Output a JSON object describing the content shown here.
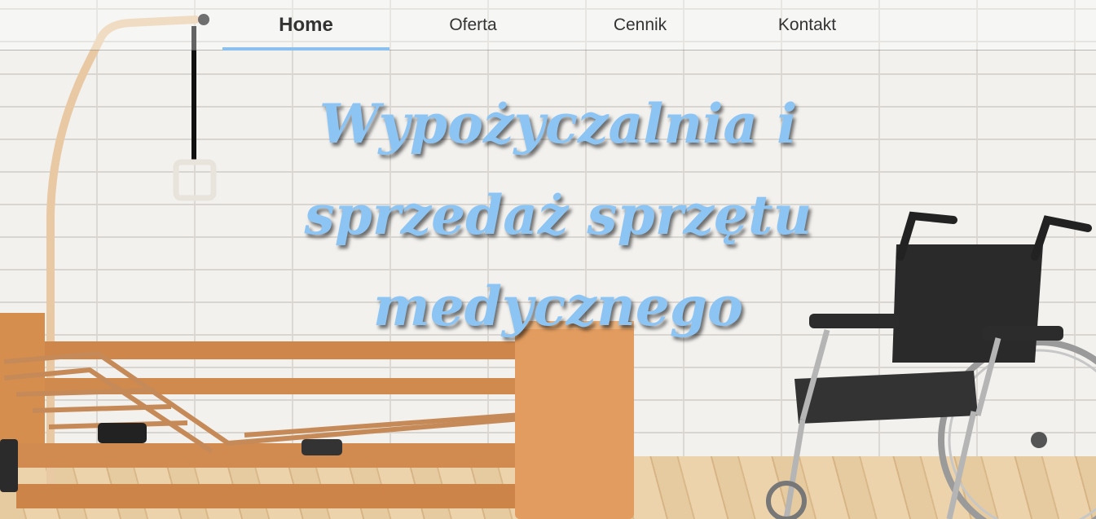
{
  "nav": {
    "items": [
      {
        "label": "Home",
        "active": true
      },
      {
        "label": "Oferta",
        "active": false
      },
      {
        "label": "Cennik",
        "active": false
      },
      {
        "label": "Kontakt",
        "active": false
      }
    ],
    "accent_color": "#8cc0ee"
  },
  "hero": {
    "title": "Wypożyczalnia i sprzedaż sprzętu medycznego",
    "title_color": "#8cc4f4"
  },
  "illustrations": [
    "hospital-bed",
    "wheelchair",
    "brick-wall",
    "wooden-floor"
  ]
}
